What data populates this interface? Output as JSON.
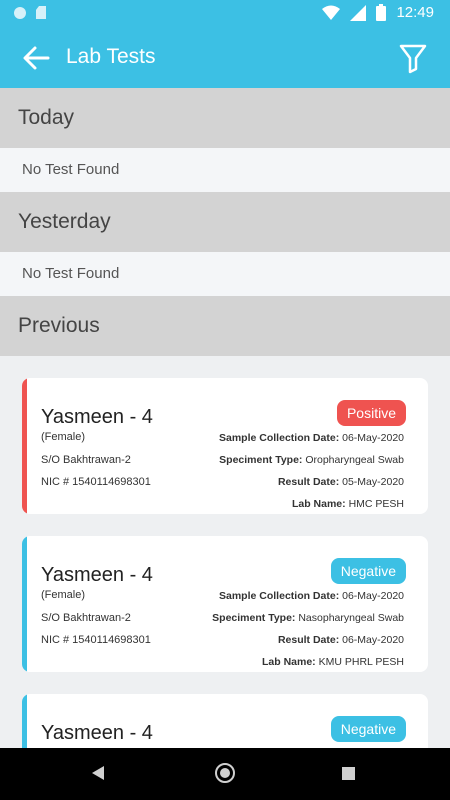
{
  "status_bar": {
    "time": "12:49"
  },
  "app_bar": {
    "title": "Lab Tests"
  },
  "sections": [
    {
      "title": "Today",
      "empty_text": "No Test Found"
    },
    {
      "title": "Yesterday",
      "empty_text": "No Test Found"
    },
    {
      "title": "Previous"
    }
  ],
  "labels": {
    "collection": "Sample Collection Date:",
    "specimen": "Speciment Type:",
    "result": "Result Date:",
    "lab": "Lab Name:"
  },
  "colors": {
    "accent": "#3cc0e4",
    "positive": "#ef5350",
    "negative": "#3cc0e4"
  },
  "tests": [
    {
      "name": "Yasmeen - 4",
      "gender": "(Female)",
      "so": "S/O Bakhtrawan-2",
      "nic": "NIC # 1540114698301",
      "status": "Positive",
      "collection_date": "06-May-2020",
      "specimen_type": "Oropharyngeal Swab",
      "result_date": "05-May-2020",
      "lab_name": "HMC PESH"
    },
    {
      "name": "Yasmeen - 4",
      "gender": "(Female)",
      "so": "S/O Bakhtrawan-2",
      "nic": "NIC # 1540114698301",
      "status": "Negative",
      "collection_date": "06-May-2020",
      "specimen_type": "Nasopharyngeal Swab",
      "result_date": "06-May-2020",
      "lab_name": "KMU PHRL PESH"
    },
    {
      "name": "Yasmeen - 4",
      "status": "Negative"
    }
  ]
}
